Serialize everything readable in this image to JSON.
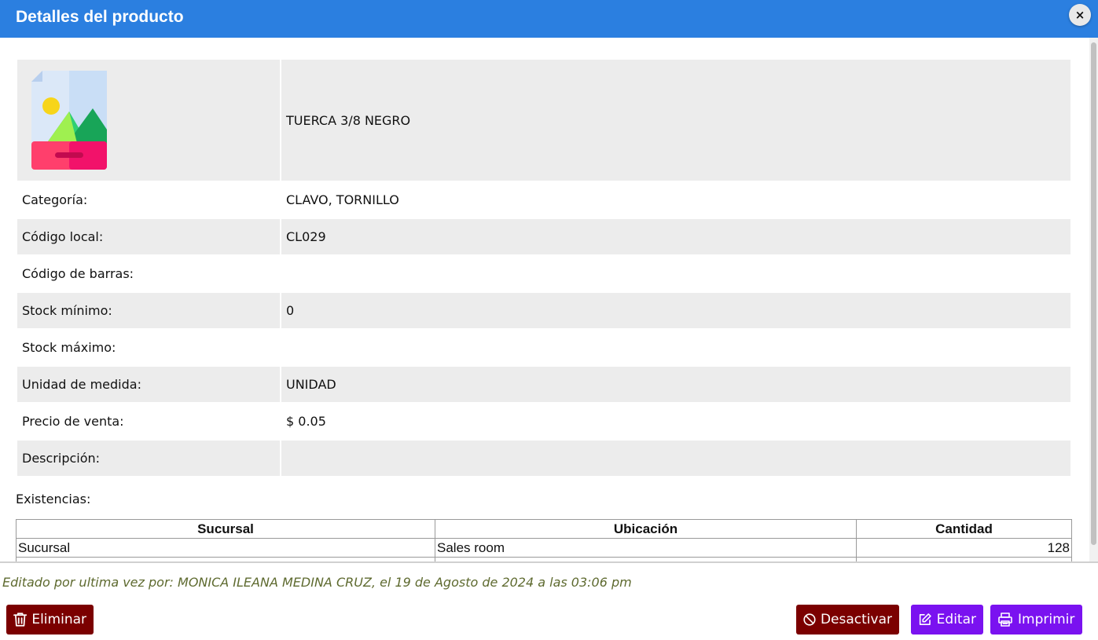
{
  "header": {
    "title": "Detalles del producto",
    "close_label": "×"
  },
  "product": {
    "name": "TUERCA 3/8 NEGRO",
    "fields": [
      {
        "label": "Categoría:",
        "value": "CLAVO, TORNILLO"
      },
      {
        "label": "Código local:",
        "value": "CL029"
      },
      {
        "label": "Código de barras:",
        "value": ""
      },
      {
        "label": "Stock mínimo:",
        "value": "0"
      },
      {
        "label": "Stock máximo:",
        "value": ""
      },
      {
        "label": "Unidad de medida:",
        "value": "UNIDAD"
      },
      {
        "label": "Precio de venta:",
        "value": "$ 0.05"
      },
      {
        "label": "Descripción:",
        "value": ""
      }
    ]
  },
  "existencias": {
    "label": "Existencias:",
    "columns": [
      "Sucursal",
      "Ubicación",
      "Cantidad"
    ],
    "rows": [
      {
        "sucursal": "Sucursal",
        "ubicacion": "Sales room",
        "cantidad": "128"
      }
    ]
  },
  "footer": {
    "edited_text": "Editado por ultima vez por: MONICA ILEANA MEDINA CRUZ, el 19 de Agosto de 2024 a las 03:06 pm",
    "buttons": {
      "delete": "Eliminar",
      "deactivate": "Desactivar",
      "edit": "Editar",
      "print": "Imprimir"
    }
  },
  "colors": {
    "header": "#2b7fe0",
    "danger": "#7b0000",
    "primary": "#7a12f0",
    "edited_text": "#5e6a2f"
  },
  "icons": {
    "product_image": "image-placeholder-icon",
    "delete": "trash-icon",
    "deactivate": "ban-icon",
    "edit": "edit-icon",
    "print": "printer-icon"
  }
}
